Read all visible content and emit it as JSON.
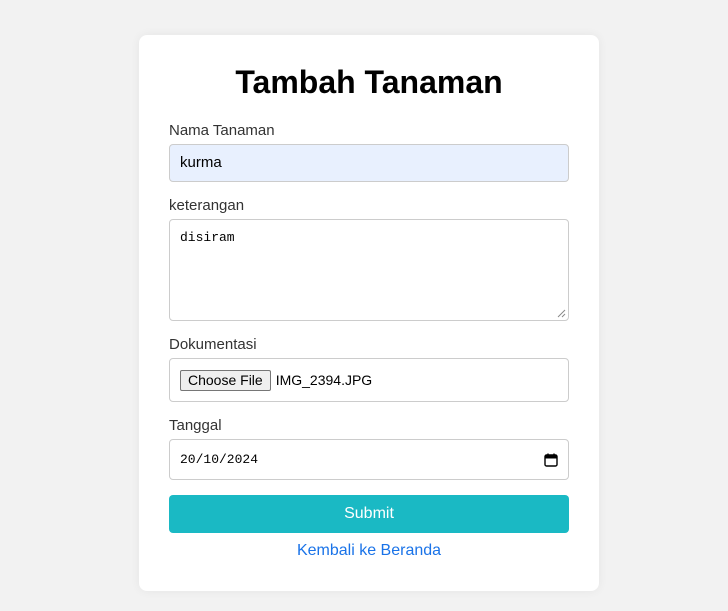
{
  "form": {
    "title": "Tambah Tanaman",
    "name_label": "Nama Tanaman",
    "name_value": "kurma",
    "desc_label": "keterangan",
    "desc_value": "disiram",
    "doc_label": "Dokumentasi",
    "file_button": "Choose File",
    "file_name": "IMG_2394.JPG",
    "date_label": "Tanggal",
    "date_value": "20/10/2024",
    "submit_label": "Submit",
    "back_link": "Kembali ke Beranda"
  },
  "colors": {
    "background": "#f2f2f2",
    "card": "#ffffff",
    "autofill": "#e8f0fe",
    "submit": "#1ab9c4",
    "link": "#1a73e8"
  },
  "icons": {
    "date_picker": "calendar-icon",
    "textarea_resize": "resize-grip-icon"
  }
}
